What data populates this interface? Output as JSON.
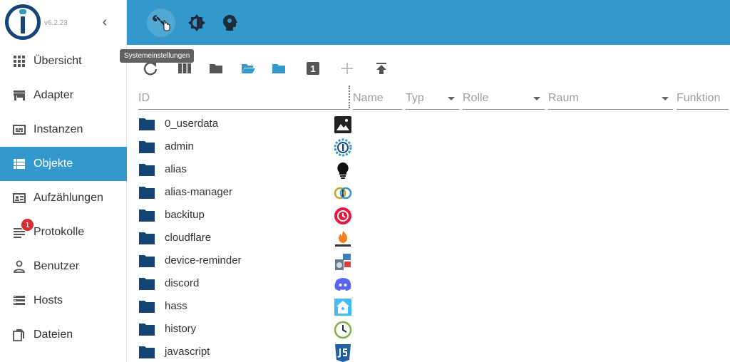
{
  "sidebar": {
    "version": "v6.2.23",
    "collapse_glyph": "‹",
    "items": [
      {
        "label": "Übersicht",
        "icon": "grid-icon"
      },
      {
        "label": "Adapter",
        "icon": "store-icon"
      },
      {
        "label": "Instanzen",
        "icon": "instances-icon"
      },
      {
        "label": "Objekte",
        "icon": "list-icon",
        "active": true
      },
      {
        "label": "Aufzählungen",
        "icon": "enum-icon"
      },
      {
        "label": "Protokolle",
        "icon": "log-icon",
        "badge": "1"
      },
      {
        "label": "Benutzer",
        "icon": "user-icon"
      },
      {
        "label": "Hosts",
        "icon": "hosts-icon"
      },
      {
        "label": "Dateien",
        "icon": "files-icon"
      }
    ]
  },
  "topbar": {
    "tooltip": "Systemeinstellungen",
    "buttons": [
      "wrench-icon",
      "theme-icon",
      "expert-mode-icon"
    ]
  },
  "toolbar": {
    "buttons": [
      "refresh-icon",
      "columns-icon",
      "folder-closed-icon",
      "folder-open-icon",
      "folder-expand-icon",
      "depth-icon",
      "add-icon",
      "upload-icon"
    ],
    "depth_value": "1"
  },
  "filters": {
    "id": "ID",
    "name": "Name",
    "typ": "Typ",
    "rolle": "Rolle",
    "raum": "Raum",
    "funktion": "Funktion"
  },
  "objects": [
    {
      "id": "0_userdata",
      "icon": "image-icon"
    },
    {
      "id": "admin",
      "icon": "iobroker-admin-icon"
    },
    {
      "id": "alias",
      "icon": "lightbulb-icon"
    },
    {
      "id": "alias-manager",
      "icon": "alias-manager-icon"
    },
    {
      "id": "backitup",
      "icon": "backitup-icon"
    },
    {
      "id": "cloudflare",
      "icon": "cloudflare-icon"
    },
    {
      "id": "device-reminder",
      "icon": "device-reminder-icon"
    },
    {
      "id": "discord",
      "icon": "discord-icon"
    },
    {
      "id": "hass",
      "icon": "hass-icon"
    },
    {
      "id": "history",
      "icon": "history-icon"
    },
    {
      "id": "javascript",
      "icon": "javascript-icon"
    }
  ],
  "colors": {
    "accent": "#3399cc",
    "folder": "#164477",
    "badge": "#d32f2f"
  }
}
